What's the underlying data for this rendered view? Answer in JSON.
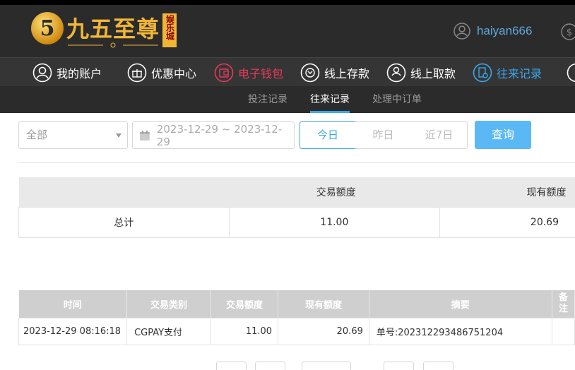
{
  "brand": {
    "badge": "5",
    "name": "九五至尊",
    "tag": "娱乐城"
  },
  "user": {
    "name": "haiyan666"
  },
  "nav": [
    {
      "label": "我的账户",
      "icon": "user-icon",
      "color": "#ffffff"
    },
    {
      "label": "优惠中心",
      "icon": "gift-icon",
      "color": "#ffffff"
    },
    {
      "label": "电子钱包",
      "icon": "wallet-icon",
      "color": "#e8395c"
    },
    {
      "label": "线上存款",
      "icon": "deposit-icon",
      "color": "#ffffff"
    },
    {
      "label": "线上取款",
      "icon": "withdraw-icon",
      "color": "#ffffff"
    },
    {
      "label": "往来记录",
      "icon": "records-icon",
      "color": "#3aa7ee"
    }
  ],
  "subnav": [
    {
      "label": "投注记录",
      "active": false
    },
    {
      "label": "往来记录",
      "active": true
    },
    {
      "label": "处理中订单",
      "active": false
    }
  ],
  "filter": {
    "type_value": "全部",
    "date_range": "2023-12-29 ~ 2023-12-29",
    "ranges": [
      {
        "label": "今日",
        "active": true
      },
      {
        "label": "昨日",
        "active": false
      },
      {
        "label": "近7日",
        "active": false
      }
    ],
    "query_label": "查询"
  },
  "summary": {
    "headers": [
      "交易额度",
      "现有额度"
    ],
    "row": {
      "label": "总计",
      "amount": "11.00",
      "balance": "20.69"
    }
  },
  "records": {
    "columns": [
      "时间",
      "交易类别",
      "交易额度",
      "现有额度",
      "摘要",
      "备注"
    ],
    "rows": [
      {
        "time": "2023-12-29 08:16:18",
        "type": "CGPAY支付",
        "amount": "11.00",
        "balance": "20.69",
        "summary": "单号:202312293486751204",
        "note": ""
      }
    ]
  },
  "colors": {
    "accent": "#3aa7ee",
    "wallet": "#e8395c",
    "gold": "#f1b636",
    "header_bg": "#2b2b2b"
  }
}
